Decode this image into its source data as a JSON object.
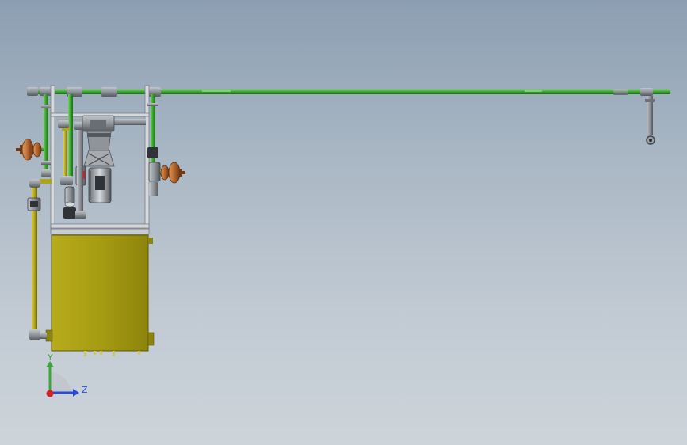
{
  "viewport": {
    "background_top": "#8c9eb2",
    "background_bottom": "#cdd4da"
  },
  "colors": {
    "green_pipe": "#33a02c",
    "yellow_pipe": "#b0a418",
    "tank": "#a69c12",
    "grey_fitting": "#8f949a",
    "bronze_valve": "#b5652f",
    "red_valve": "#d01f1f",
    "frame": "#c9ccd0",
    "axis_y": "#3aa63a",
    "axis_z": "#2a49d6",
    "axis_x": "#d32020"
  },
  "triad": {
    "y_label": "Y",
    "z_label": "Z"
  }
}
